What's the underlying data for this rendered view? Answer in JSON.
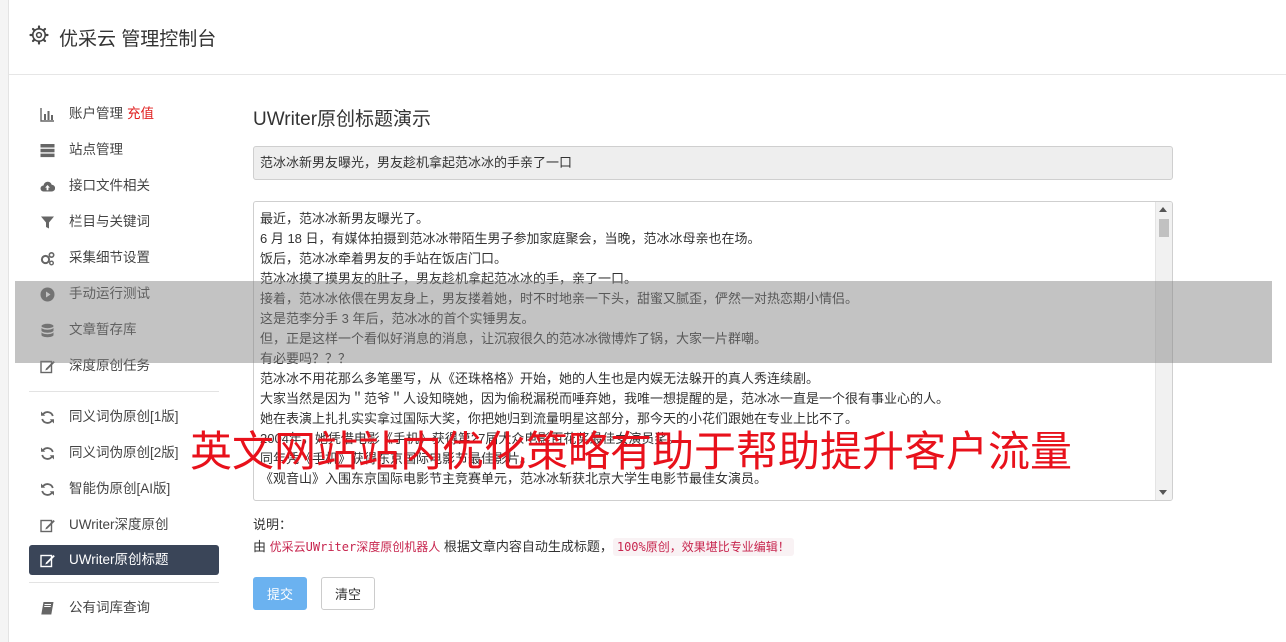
{
  "header": {
    "title": "优采云 管理控制台",
    "icon": "gear-icon"
  },
  "sidebar": {
    "items": [
      {
        "label": "账户管理",
        "badge": "充值",
        "icon": "bar-chart-icon"
      },
      {
        "label": "站点管理",
        "icon": "server-icon"
      },
      {
        "label": "接口文件相关",
        "icon": "cloud-upload-icon"
      },
      {
        "label": "栏目与关键词",
        "icon": "filter-icon"
      },
      {
        "label": "采集细节设置",
        "icon": "cogs-icon"
      },
      {
        "label": "手动运行测试",
        "icon": "play-circle-icon"
      },
      {
        "label": "文章暂存库",
        "icon": "database-icon"
      },
      {
        "label": "深度原创任务",
        "icon": "edit-icon"
      },
      {
        "label": "同义词伪原创[1版]",
        "icon": "refresh-icon"
      },
      {
        "label": "同义词伪原创[2版]",
        "icon": "refresh-icon"
      },
      {
        "label": "智能伪原创[AI版]",
        "icon": "refresh-icon"
      },
      {
        "label": "UWriter深度原创",
        "icon": "edit-icon"
      },
      {
        "label": "UWriter原创标题",
        "icon": "edit-icon",
        "active": true
      },
      {
        "label": "公有词库查询",
        "icon": "book-icon"
      }
    ]
  },
  "main": {
    "heading": "UWriter原创标题演示",
    "title_value": "范冰冰新男友曝光，男友趁机拿起范冰冰的手亲了一口",
    "article_lines": [
      "最近，范冰冰新男友曝光了。",
      "6 月 18 日，有媒体拍摄到范冰冰带陌生男子参加家庭聚会，当晚，范冰冰母亲也在场。",
      "饭后，范冰冰牵着男友的手站在饭店门口。",
      "范冰冰摸了摸男友的肚子，男友趁机拿起范冰冰的手，亲了一口。",
      "接着，范冰冰依偎在男友身上，男友搂着她，时不时地亲一下头，甜蜜又腻歪，俨然一对热恋期小情侣。",
      "这是范李分手 3 年后，范冰冰的首个实锤男友。",
      "但，正是这样一个看似好消息的消息，让沉寂很久的范冰冰微博炸了锅，大家一片群嘲。",
      "有必要吗？？？",
      "范冰冰不用花那么多笔墨写，从《还珠格格》开始，她的人生也是内娱无法躲开的真人秀连续剧。",
      "大家当然是因为＂范爷＂人设知晓她，因为偷税漏税而唾弃她，我唯一想提醒的是，范冰冰一直是一个很有事业心的人。",
      "她在表演上扎扎实实拿过国际大奖，你把她归到流量明星这部分，那今天的小花们跟她在专业上比不了。",
      "2004年，她凭借电影《手机》获得第27届大众电影百花奖最佳女演员奖。",
      "同年凭《手机》获得东京国际电影节最佳影片。",
      "《观音山》入围东京国际电影节主竞赛单元，范冰冰斩获北京大学生电影节最佳女演员。"
    ],
    "note_label": "说明：",
    "note_prefix": "由",
    "note_link": "优采云UWriter深度原创机器人",
    "note_middle": "根据文章内容自动生成标题，",
    "note_code": "100%原创，效果堪比专业编辑！",
    "submit_label": "提交",
    "clear_label": "清空"
  },
  "overlay": {
    "caption": "英文网站站内优化策略有助于帮助提升客户流量"
  },
  "colors": {
    "active_nav_bg": "#3a4558",
    "submit_bg": "#6bb2f0",
    "badge_red": "#e02020",
    "caption_red": "#e8111b"
  }
}
